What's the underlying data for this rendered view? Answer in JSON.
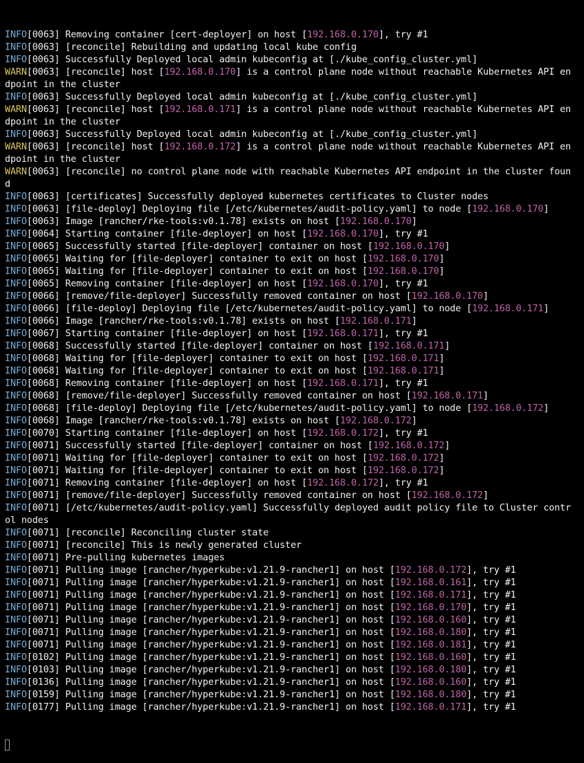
{
  "terminal": {
    "lines": [
      {
        "segments": [
          {
            "t": "INFO",
            "k": "info"
          },
          {
            "t": "[0063] Removing container [cert-deployer] on host [",
            "k": "txt"
          },
          {
            "t": "192.168.0.170",
            "k": "ip"
          },
          {
            "t": "], try #1",
            "k": "txt"
          }
        ]
      },
      {
        "segments": [
          {
            "t": "INFO",
            "k": "info"
          },
          {
            "t": "[0063] [reconcile] Rebuilding and updating local kube config",
            "k": "txt"
          }
        ]
      },
      {
        "segments": [
          {
            "t": "INFO",
            "k": "info"
          },
          {
            "t": "[0063] Successfully Deployed local admin kubeconfig at [./kube_config_cluster.yml]",
            "k": "txt"
          }
        ]
      },
      {
        "segments": [
          {
            "t": "WARN",
            "k": "warn"
          },
          {
            "t": "[0063] [reconcile] host [",
            "k": "txt"
          },
          {
            "t": "192.168.0.170",
            "k": "ip"
          },
          {
            "t": "] is a control plane node without reachable Kubernetes API en",
            "k": "txt"
          }
        ]
      },
      {
        "segments": [
          {
            "t": "dpoint in the cluster",
            "k": "txt"
          }
        ]
      },
      {
        "segments": [
          {
            "t": "INFO",
            "k": "info"
          },
          {
            "t": "[0063] Successfully Deployed local admin kubeconfig at [./kube_config_cluster.yml]",
            "k": "txt"
          }
        ]
      },
      {
        "segments": [
          {
            "t": "WARN",
            "k": "warn"
          },
          {
            "t": "[0063] [reconcile] host [",
            "k": "txt"
          },
          {
            "t": "192.168.0.171",
            "k": "ip"
          },
          {
            "t": "] is a control plane node without reachable Kubernetes API en",
            "k": "txt"
          }
        ]
      },
      {
        "segments": [
          {
            "t": "dpoint in the cluster",
            "k": "txt"
          }
        ]
      },
      {
        "segments": [
          {
            "t": "INFO",
            "k": "info"
          },
          {
            "t": "[0063] Successfully Deployed local admin kubeconfig at [./kube_config_cluster.yml]",
            "k": "txt"
          }
        ]
      },
      {
        "segments": [
          {
            "t": "WARN",
            "k": "warn"
          },
          {
            "t": "[0063] [reconcile] host [",
            "k": "txt"
          },
          {
            "t": "192.168.0.172",
            "k": "ip"
          },
          {
            "t": "] is a control plane node without reachable Kubernetes API en",
            "k": "txt"
          }
        ]
      },
      {
        "segments": [
          {
            "t": "dpoint in the cluster",
            "k": "txt"
          }
        ]
      },
      {
        "segments": [
          {
            "t": "WARN",
            "k": "warn"
          },
          {
            "t": "[0063] [reconcile] no control plane node with reachable Kubernetes API endpoint in the cluster foun",
            "k": "txt"
          }
        ]
      },
      {
        "segments": [
          {
            "t": "d",
            "k": "txt"
          }
        ]
      },
      {
        "segments": [
          {
            "t": "INFO",
            "k": "info"
          },
          {
            "t": "[0063] [certificates] Successfully deployed kubernetes certificates to Cluster nodes",
            "k": "txt"
          }
        ]
      },
      {
        "segments": [
          {
            "t": "INFO",
            "k": "info"
          },
          {
            "t": "[0063] [file-deploy] Deploying file [/etc/kubernetes/audit-policy.yaml] to node [",
            "k": "txt"
          },
          {
            "t": "192.168.0.170",
            "k": "ip"
          },
          {
            "t": "]",
            "k": "txt"
          }
        ]
      },
      {
        "segments": [
          {
            "t": "INFO",
            "k": "info"
          },
          {
            "t": "[0063] Image [rancher/rke-tools:v0.1.78] exists on host [",
            "k": "txt"
          },
          {
            "t": "192.168.0.170",
            "k": "ip"
          },
          {
            "t": "]",
            "k": "txt"
          }
        ]
      },
      {
        "segments": [
          {
            "t": "INFO",
            "k": "info"
          },
          {
            "t": "[0064] Starting container [file-deployer] on host [",
            "k": "txt"
          },
          {
            "t": "192.168.0.170",
            "k": "ip"
          },
          {
            "t": "], try #1",
            "k": "txt"
          }
        ]
      },
      {
        "segments": [
          {
            "t": "INFO",
            "k": "info"
          },
          {
            "t": "[0065] Successfully started [file-deployer] container on host [",
            "k": "txt"
          },
          {
            "t": "192.168.0.170",
            "k": "ip"
          },
          {
            "t": "]",
            "k": "txt"
          }
        ]
      },
      {
        "segments": [
          {
            "t": "INFO",
            "k": "info"
          },
          {
            "t": "[0065] Waiting for [file-deployer] container to exit on host [",
            "k": "txt"
          },
          {
            "t": "192.168.0.170",
            "k": "ip"
          },
          {
            "t": "]",
            "k": "txt"
          }
        ]
      },
      {
        "segments": [
          {
            "t": "INFO",
            "k": "info"
          },
          {
            "t": "[0065] Waiting for [file-deployer] container to exit on host [",
            "k": "txt"
          },
          {
            "t": "192.168.0.170",
            "k": "ip"
          },
          {
            "t": "]",
            "k": "txt"
          }
        ]
      },
      {
        "segments": [
          {
            "t": "INFO",
            "k": "info"
          },
          {
            "t": "[0065] Removing container [file-deployer] on host [",
            "k": "txt"
          },
          {
            "t": "192.168.0.170",
            "k": "ip"
          },
          {
            "t": "], try #1",
            "k": "txt"
          }
        ]
      },
      {
        "segments": [
          {
            "t": "INFO",
            "k": "info"
          },
          {
            "t": "[0066] [remove/file-deployer] Successfully removed container on host [",
            "k": "txt"
          },
          {
            "t": "192.168.0.170",
            "k": "ip"
          },
          {
            "t": "]",
            "k": "txt"
          }
        ]
      },
      {
        "segments": [
          {
            "t": "INFO",
            "k": "info"
          },
          {
            "t": "[0066] [file-deploy] Deploying file [/etc/kubernetes/audit-policy.yaml] to node [",
            "k": "txt"
          },
          {
            "t": "192.168.0.171",
            "k": "ip"
          },
          {
            "t": "]",
            "k": "txt"
          }
        ]
      },
      {
        "segments": [
          {
            "t": "INFO",
            "k": "info"
          },
          {
            "t": "[0066] Image [rancher/rke-tools:v0.1.78] exists on host [",
            "k": "txt"
          },
          {
            "t": "192.168.0.171",
            "k": "ip"
          },
          {
            "t": "]",
            "k": "txt"
          }
        ]
      },
      {
        "segments": [
          {
            "t": "INFO",
            "k": "info"
          },
          {
            "t": "[0067] Starting container [file-deployer] on host [",
            "k": "txt"
          },
          {
            "t": "192.168.0.171",
            "k": "ip"
          },
          {
            "t": "], try #1",
            "k": "txt"
          }
        ]
      },
      {
        "segments": [
          {
            "t": "INFO",
            "k": "info"
          },
          {
            "t": "[0068] Successfully started [file-deployer] container on host [",
            "k": "txt"
          },
          {
            "t": "192.168.0.171",
            "k": "ip"
          },
          {
            "t": "]",
            "k": "txt"
          }
        ]
      },
      {
        "segments": [
          {
            "t": "INFO",
            "k": "info"
          },
          {
            "t": "[0068] Waiting for [file-deployer] container to exit on host [",
            "k": "txt"
          },
          {
            "t": "192.168.0.171",
            "k": "ip"
          },
          {
            "t": "]",
            "k": "txt"
          }
        ]
      },
      {
        "segments": [
          {
            "t": "INFO",
            "k": "info"
          },
          {
            "t": "[0068] Waiting for [file-deployer] container to exit on host [",
            "k": "txt"
          },
          {
            "t": "192.168.0.171",
            "k": "ip"
          },
          {
            "t": "]",
            "k": "txt"
          }
        ]
      },
      {
        "segments": [
          {
            "t": "INFO",
            "k": "info"
          },
          {
            "t": "[0068] Removing container [file-deployer] on host [",
            "k": "txt"
          },
          {
            "t": "192.168.0.171",
            "k": "ip"
          },
          {
            "t": "], try #1",
            "k": "txt"
          }
        ]
      },
      {
        "segments": [
          {
            "t": "INFO",
            "k": "info"
          },
          {
            "t": "[0068] [remove/file-deployer] Successfully removed container on host [",
            "k": "txt"
          },
          {
            "t": "192.168.0.171",
            "k": "ip"
          },
          {
            "t": "]",
            "k": "txt"
          }
        ]
      },
      {
        "segments": [
          {
            "t": "INFO",
            "k": "info"
          },
          {
            "t": "[0068] [file-deploy] Deploying file [/etc/kubernetes/audit-policy.yaml] to node [",
            "k": "txt"
          },
          {
            "t": "192.168.0.172",
            "k": "ip"
          },
          {
            "t": "]",
            "k": "txt"
          }
        ]
      },
      {
        "segments": [
          {
            "t": "INFO",
            "k": "info"
          },
          {
            "t": "[0068] Image [rancher/rke-tools:v0.1.78] exists on host [",
            "k": "txt"
          },
          {
            "t": "192.168.0.172",
            "k": "ip"
          },
          {
            "t": "]",
            "k": "txt"
          }
        ]
      },
      {
        "segments": [
          {
            "t": "INFO",
            "k": "info"
          },
          {
            "t": "[0070] Starting container [file-deployer] on host [",
            "k": "txt"
          },
          {
            "t": "192.168.0.172",
            "k": "ip"
          },
          {
            "t": "], try #1",
            "k": "txt"
          }
        ]
      },
      {
        "segments": [
          {
            "t": "INFO",
            "k": "info"
          },
          {
            "t": "[0071] Successfully started [file-deployer] container on host [",
            "k": "txt"
          },
          {
            "t": "192.168.0.172",
            "k": "ip"
          },
          {
            "t": "]",
            "k": "txt"
          }
        ]
      },
      {
        "segments": [
          {
            "t": "INFO",
            "k": "info"
          },
          {
            "t": "[0071] Waiting for [file-deployer] container to exit on host [",
            "k": "txt"
          },
          {
            "t": "192.168.0.172",
            "k": "ip"
          },
          {
            "t": "]",
            "k": "txt"
          }
        ]
      },
      {
        "segments": [
          {
            "t": "INFO",
            "k": "info"
          },
          {
            "t": "[0071] Waiting for [file-deployer] container to exit on host [",
            "k": "txt"
          },
          {
            "t": "192.168.0.172",
            "k": "ip"
          },
          {
            "t": "]",
            "k": "txt"
          }
        ]
      },
      {
        "segments": [
          {
            "t": "INFO",
            "k": "info"
          },
          {
            "t": "[0071] Removing container [file-deployer] on host [",
            "k": "txt"
          },
          {
            "t": "192.168.0.172",
            "k": "ip"
          },
          {
            "t": "], try #1",
            "k": "txt"
          }
        ]
      },
      {
        "segments": [
          {
            "t": "INFO",
            "k": "info"
          },
          {
            "t": "[0071] [remove/file-deployer] Successfully removed container on host [",
            "k": "txt"
          },
          {
            "t": "192.168.0.172",
            "k": "ip"
          },
          {
            "t": "]",
            "k": "txt"
          }
        ]
      },
      {
        "segments": [
          {
            "t": "INFO",
            "k": "info"
          },
          {
            "t": "[0071] [/etc/kubernetes/audit-policy.yaml] Successfully deployed audit policy file to Cluster contr",
            "k": "txt"
          }
        ]
      },
      {
        "segments": [
          {
            "t": "ol nodes",
            "k": "txt"
          }
        ]
      },
      {
        "segments": [
          {
            "t": "INFO",
            "k": "info"
          },
          {
            "t": "[0071] [reconcile] Reconciling cluster state",
            "k": "txt"
          }
        ]
      },
      {
        "segments": [
          {
            "t": "INFO",
            "k": "info"
          },
          {
            "t": "[0071] [reconcile] This is newly generated cluster",
            "k": "txt"
          }
        ]
      },
      {
        "segments": [
          {
            "t": "INFO",
            "k": "info"
          },
          {
            "t": "[0071] Pre-pulling kubernetes images",
            "k": "txt"
          }
        ]
      },
      {
        "segments": [
          {
            "t": "INFO",
            "k": "info"
          },
          {
            "t": "[0071] Pulling image [rancher/hyperkube:v1.21.9-rancher1] on host [",
            "k": "txt"
          },
          {
            "t": "192.168.0.172",
            "k": "ip"
          },
          {
            "t": "], try #1",
            "k": "txt"
          }
        ]
      },
      {
        "segments": [
          {
            "t": "INFO",
            "k": "info"
          },
          {
            "t": "[0071] Pulling image [rancher/hyperkube:v1.21.9-rancher1] on host [",
            "k": "txt"
          },
          {
            "t": "192.168.0.161",
            "k": "ip"
          },
          {
            "t": "], try #1",
            "k": "txt"
          }
        ]
      },
      {
        "segments": [
          {
            "t": "INFO",
            "k": "info"
          },
          {
            "t": "[0071] Pulling image [rancher/hyperkube:v1.21.9-rancher1] on host [",
            "k": "txt"
          },
          {
            "t": "192.168.0.171",
            "k": "ip"
          },
          {
            "t": "], try #1",
            "k": "txt"
          }
        ]
      },
      {
        "segments": [
          {
            "t": "INFO",
            "k": "info"
          },
          {
            "t": "[0071] Pulling image [rancher/hyperkube:v1.21.9-rancher1] on host [",
            "k": "txt"
          },
          {
            "t": "192.168.0.170",
            "k": "ip"
          },
          {
            "t": "], try #1",
            "k": "txt"
          }
        ]
      },
      {
        "segments": [
          {
            "t": "INFO",
            "k": "info"
          },
          {
            "t": "[0071] Pulling image [rancher/hyperkube:v1.21.9-rancher1] on host [",
            "k": "txt"
          },
          {
            "t": "192.168.0.160",
            "k": "ip"
          },
          {
            "t": "], try #1",
            "k": "txt"
          }
        ]
      },
      {
        "segments": [
          {
            "t": "INFO",
            "k": "info"
          },
          {
            "t": "[0071] Pulling image [rancher/hyperkube:v1.21.9-rancher1] on host [",
            "k": "txt"
          },
          {
            "t": "192.168.0.180",
            "k": "ip"
          },
          {
            "t": "], try #1",
            "k": "txt"
          }
        ]
      },
      {
        "segments": [
          {
            "t": "INFO",
            "k": "info"
          },
          {
            "t": "[0071] Pulling image [rancher/hyperkube:v1.21.9-rancher1] on host [",
            "k": "txt"
          },
          {
            "t": "192.168.0.181",
            "k": "ip"
          },
          {
            "t": "], try #1",
            "k": "txt"
          }
        ]
      },
      {
        "segments": [
          {
            "t": "INFO",
            "k": "info"
          },
          {
            "t": "[0102] Pulling image [rancher/hyperkube:v1.21.9-rancher1] on host [",
            "k": "txt"
          },
          {
            "t": "192.168.0.160",
            "k": "ip"
          },
          {
            "t": "], try #1",
            "k": "txt"
          }
        ]
      },
      {
        "segments": [
          {
            "t": "INFO",
            "k": "info"
          },
          {
            "t": "[0103] Pulling image [rancher/hyperkube:v1.21.9-rancher1] on host [",
            "k": "txt"
          },
          {
            "t": "192.168.0.180",
            "k": "ip"
          },
          {
            "t": "], try #1",
            "k": "txt"
          }
        ]
      },
      {
        "segments": [
          {
            "t": "INFO",
            "k": "info"
          },
          {
            "t": "[0136] Pulling image [rancher/hyperkube:v1.21.9-rancher1] on host [",
            "k": "txt"
          },
          {
            "t": "192.168.0.160",
            "k": "ip"
          },
          {
            "t": "], try #1",
            "k": "txt"
          }
        ]
      },
      {
        "segments": [
          {
            "t": "INFO",
            "k": "info"
          },
          {
            "t": "[0159] Pulling image [rancher/hyperkube:v1.21.9-rancher1] on host [",
            "k": "txt"
          },
          {
            "t": "192.168.0.180",
            "k": "ip"
          },
          {
            "t": "], try #1",
            "k": "txt"
          }
        ]
      },
      {
        "segments": [
          {
            "t": "INFO",
            "k": "info"
          },
          {
            "t": "[0177] Pulling image [rancher/hyperkube:v1.21.9-rancher1] on host [",
            "k": "txt"
          },
          {
            "t": "192.168.0.171",
            "k": "ip"
          },
          {
            "t": "], try #1",
            "k": "txt"
          }
        ]
      }
    ]
  },
  "colors": {
    "background": "#000000",
    "info": "#7aaed6",
    "warn": "#d8c55e",
    "ip": "#c065a8",
    "text": "#f2f2f2"
  }
}
